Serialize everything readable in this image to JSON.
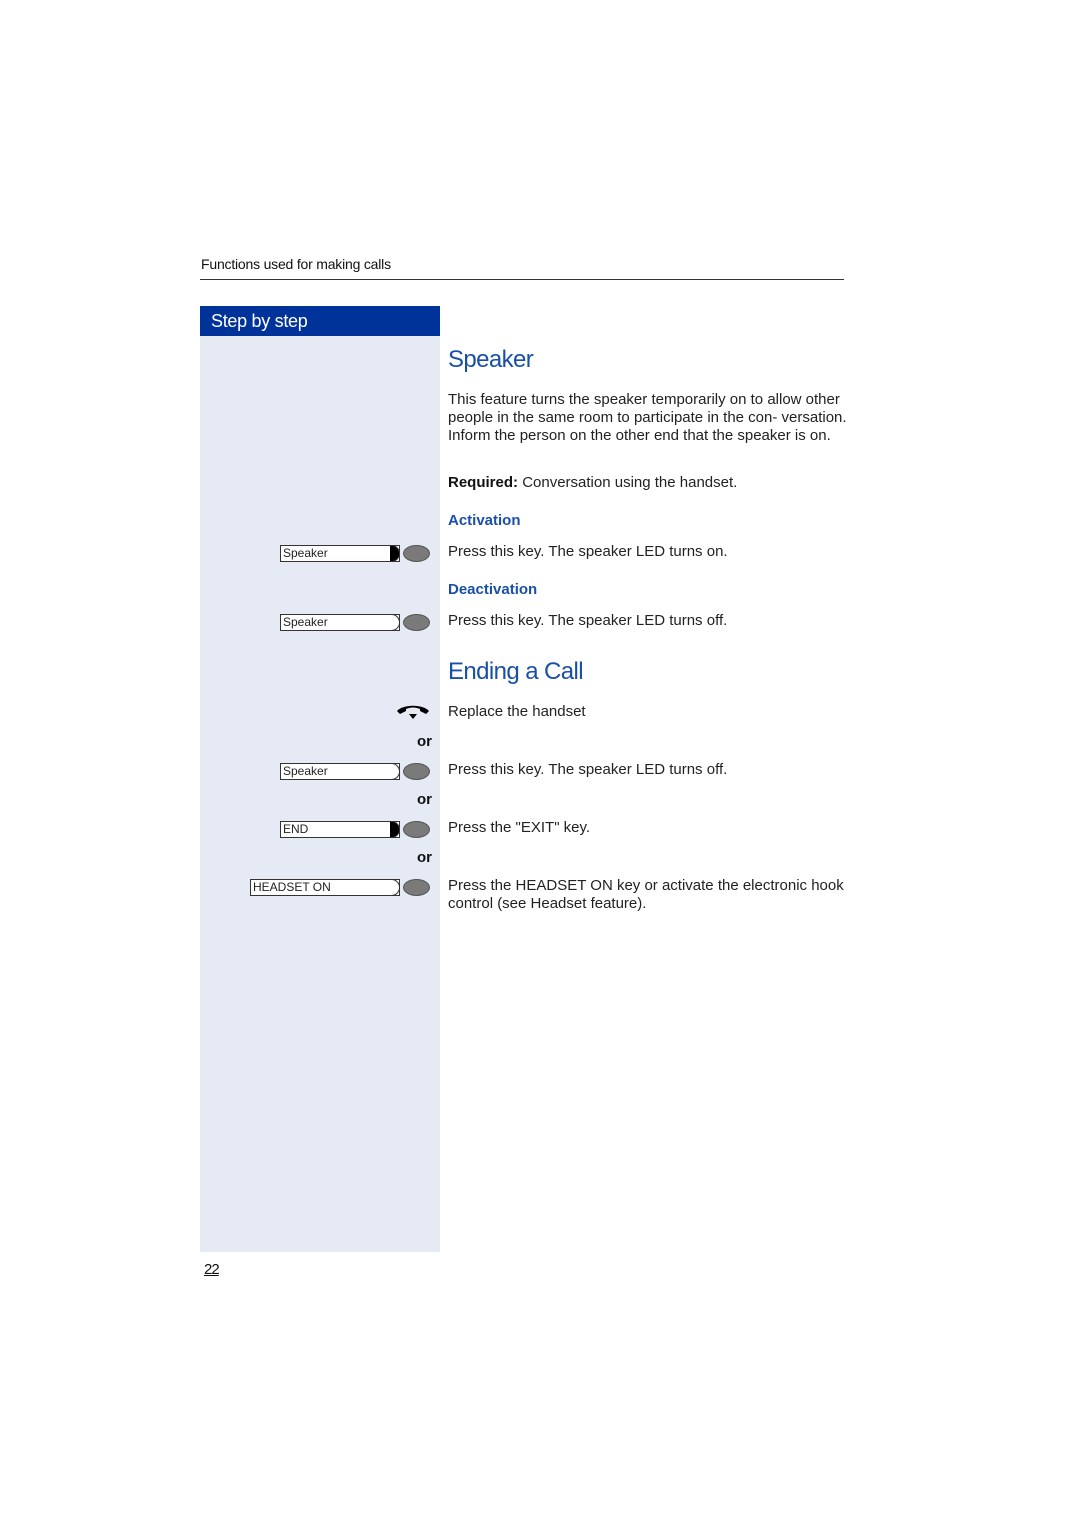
{
  "header": {
    "title": "Functions used for making calls"
  },
  "sidebar": {
    "title": "Step by step"
  },
  "page_number": "22",
  "sections": {
    "speaker": {
      "title": "Speaker",
      "intro": "This feature turns the speaker temporarily on to allow other people in the same room to participate in the con- versation. Inform the person on the other end that the speaker is on.",
      "required_label": "Required:",
      "required_text": "Conversation using the handset.",
      "activation": {
        "heading": "Activation",
        "key_label": "Speaker",
        "led": "on",
        "text": "Press this key. The speaker LED turns on."
      },
      "deactivation": {
        "heading": "Deactivation",
        "key_label": "Speaker",
        "led": "off",
        "text": "Press this key. The speaker LED turns off."
      }
    },
    "ending": {
      "title": "Ending a Call",
      "or_label": "or",
      "steps": [
        {
          "icon": "handset-hangup-icon",
          "text": "Replace the handset"
        },
        {
          "key_label": "Speaker",
          "led": "off",
          "text": "Press this key. The speaker LED turns off."
        },
        {
          "key_label": "END",
          "led": "on",
          "text": "Press the \"EXIT\" key."
        },
        {
          "key_label": "HEADSET ON",
          "led": "off",
          "text": "Press the HEADSET ON key or activate the electronic hook control (see Headset feature)."
        }
      ]
    }
  }
}
